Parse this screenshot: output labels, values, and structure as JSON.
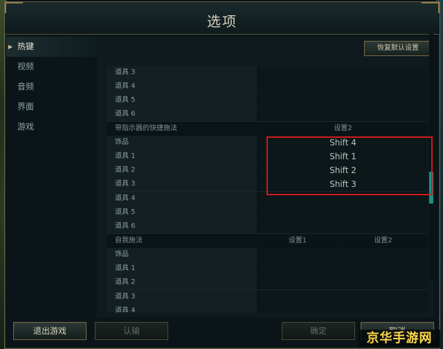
{
  "window": {
    "title": "选项"
  },
  "sidebar": {
    "items": [
      {
        "label": "热键",
        "active": true
      },
      {
        "label": "视频",
        "active": false
      },
      {
        "label": "音频",
        "active": false
      },
      {
        "label": "界面",
        "active": false
      },
      {
        "label": "游戏",
        "active": false
      }
    ]
  },
  "toolbar": {
    "reset_label": "恢复默认设置"
  },
  "hotkeys": {
    "rows": [
      {
        "label": "道具 3"
      },
      {
        "label": "道具 4"
      },
      {
        "label": "道具 5"
      },
      {
        "label": "道具 6"
      },
      {
        "label": "带指示器的快捷施法",
        "col1": "设置2",
        "header": true
      },
      {
        "label": "饰品",
        "col1": "Shift 4"
      },
      {
        "label": "道具 1",
        "col1": "Shift 1"
      },
      {
        "label": "道具 2",
        "col1": "Shift 2"
      },
      {
        "label": "道具 3",
        "col1": "Shift 3"
      },
      {
        "label": "道具 4"
      },
      {
        "label": "道具 5"
      },
      {
        "label": "道具 6"
      },
      {
        "label": "自我施法",
        "col1": "设置1",
        "col2": "设置2",
        "header": true
      },
      {
        "label": "饰品"
      },
      {
        "label": "道具 1"
      },
      {
        "label": "道具 2"
      },
      {
        "label": "道具 3"
      },
      {
        "label": "道具 4"
      }
    ]
  },
  "footer": {
    "exit_label": "退出游戏",
    "confirm_label": "认输",
    "ok_label": "确定",
    "cancel_label": "取消"
  },
  "watermark": {
    "text": "京华手游网"
  },
  "colors": {
    "highlight": "#d41a1a",
    "accent_gold": "#7a6d48",
    "scroll_thumb": "#1f8f86"
  }
}
